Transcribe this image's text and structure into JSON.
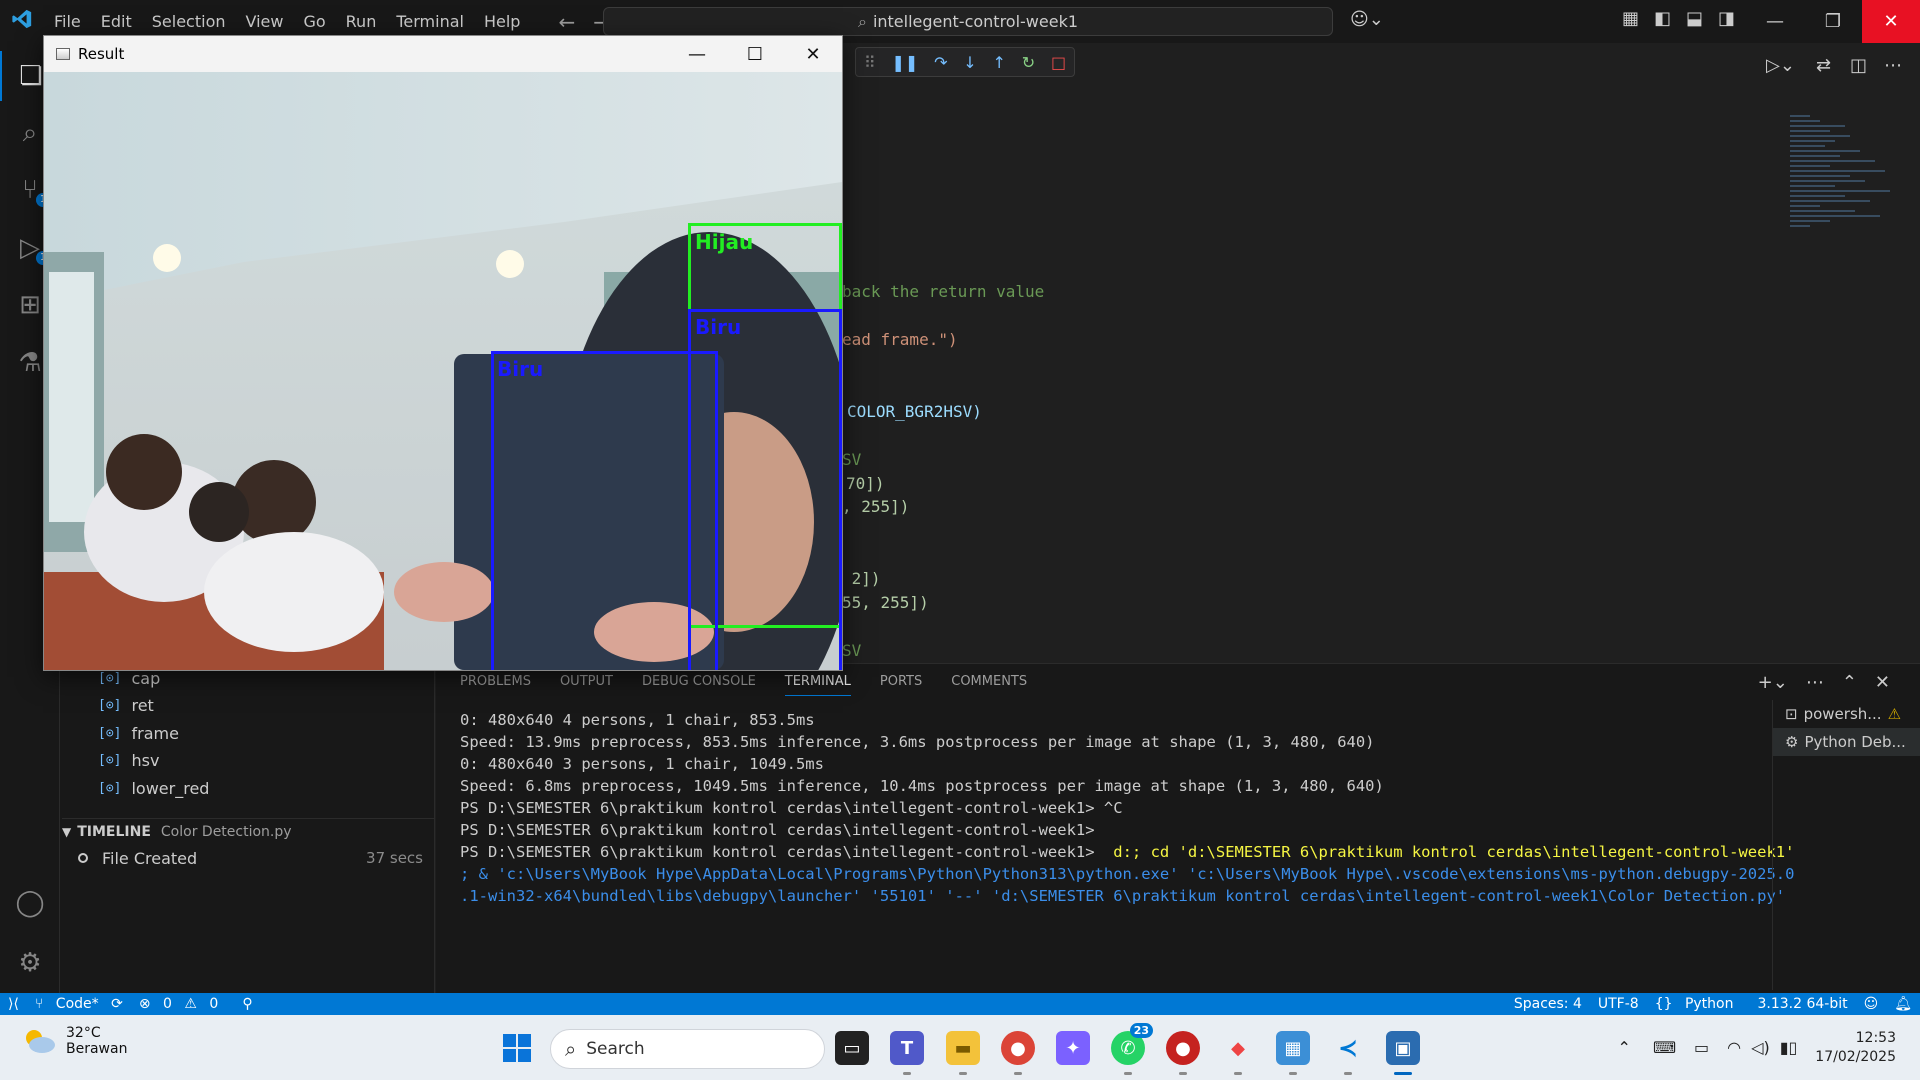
{
  "window": {
    "menu": [
      "File",
      "Edit",
      "Selection",
      "View",
      "Go",
      "Run",
      "Terminal",
      "Help"
    ],
    "search": "intellegent-control-week1"
  },
  "outline": [
    "cap",
    "ret",
    "frame",
    "hsv",
    "lower_red"
  ],
  "timeline": {
    "title": "TIMELINE",
    "file": "Color Detection.py",
    "entry": "File Created",
    "age": "37 secs"
  },
  "code_fragments": [
    "back the return value",
    "ead frame.\")",
    "COLOR_BGR2HSV)",
    "SV",
    "70])",
    ", 255])",
    " 2])",
    "55, 255])",
    "SV"
  ],
  "result_window": {
    "title": "Result",
    "detections": [
      {
        "label": "Hijau",
        "color": "#22ee22"
      },
      {
        "label": "Biru",
        "color": "#1a1aff"
      },
      {
        "label": "Biru",
        "color": "#1a1aff"
      }
    ]
  },
  "panel": {
    "tabs": [
      "PROBLEMS",
      "OUTPUT",
      "DEBUG CONSOLE",
      "TERMINAL",
      "PORTS",
      "COMMENTS"
    ],
    "active_tab": "TERMINAL",
    "terminal_lines": [
      "0: 480x640 4 persons, 1 chair, 853.5ms",
      "Speed: 13.9ms preprocess, 853.5ms inference, 3.6ms postprocess per image at shape (1, 3, 480, 640)",
      "",
      "0: 480x640 3 persons, 1 chair, 1049.5ms",
      "Speed: 6.8ms preprocess, 1049.5ms inference, 10.4ms postprocess per image at shape (1, 3, 480, 640)",
      "",
      "PS D:\\SEMESTER 6\\praktikum kontrol cerdas\\intellegent-control-week1> ^C",
      "PS D:\\SEMESTER 6\\praktikum kontrol cerdas\\intellegent-control-week1>",
      "PS D:\\SEMESTER 6\\praktikum kontrol cerdas\\intellegent-control-week1> "
    ],
    "command_line1": " d:; cd 'd:\\SEMESTER 6\\praktikum kontrol cerdas\\intellegent-control-week1'",
    "command_line2": "; & 'c:\\Users\\MyBook Hype\\AppData\\Local\\Programs\\Python\\Python313\\python.exe' 'c:\\Users\\MyBook Hype\\.vscode\\extensions\\ms-python.debugpy-2025.0",
    "command_line3": ".1-win32-x64\\bundled\\libs\\debugpy\\launcher' '55101' '--' 'd:\\SEMESTER 6\\praktikum kontrol cerdas\\intellegent-control-week1\\Color Detection.py'",
    "terminals": [
      "powersh...",
      "Python Deb..."
    ]
  },
  "statusbar": {
    "branch": "Code*",
    "errors": "0",
    "warnings": "0",
    "spaces": "Spaces: 4",
    "encoding": "UTF-8",
    "language": "Python",
    "interpreter": "3.13.2 64-bit"
  },
  "taskbar": {
    "temperature": "32°C",
    "weather": "Berawan",
    "search_placeholder": "Search",
    "whatsapp_badge": "23",
    "time": "12:53",
    "date": "17/02/2025"
  },
  "colors": {
    "accent": "#0078d4",
    "close": "#e81123",
    "detect_green": "#22ee22",
    "detect_blue": "#1a1aff"
  }
}
